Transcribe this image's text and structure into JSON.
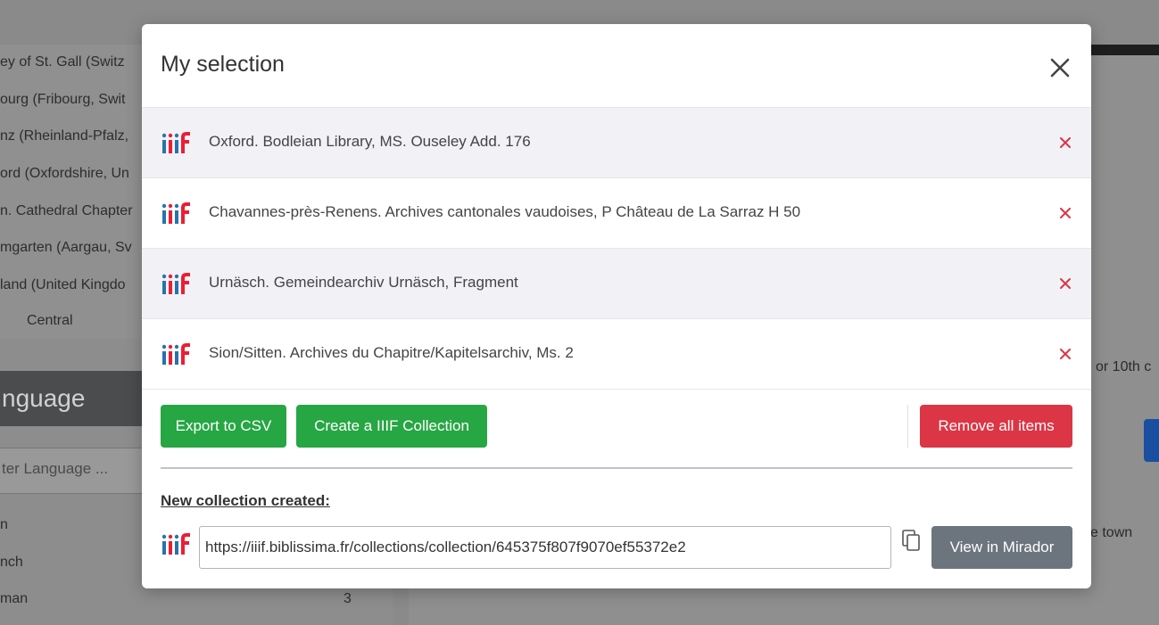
{
  "background": {
    "sidebar_items": [
      "ey of St. Gall (Switz",
      "ourg (Fribourg, Swit",
      "nz (Rheinland-Pfalz,",
      "ord (Oxfordshire, Un",
      "n. Cathedral Chapter",
      "mgarten (Aargau, Sv",
      "land (United Kingdo",
      "Central"
    ],
    "language_title": "nguage",
    "filter_placeholder": "ter Language ...",
    "language_rows": [
      "n",
      "nch",
      "man"
    ],
    "language_count": "3",
    "right_text_1": "or 10th c",
    "right_text_2": "e town"
  },
  "modal": {
    "title": "My selection",
    "items": [
      {
        "label": "Oxford. Bodleian Library, MS. Ouseley Add. 176"
      },
      {
        "label": "Chavannes-près-Renens. Archives cantonales vaudoises, P Château de La Sarraz H 50"
      },
      {
        "label": "Urnäsch. Gemeindearchiv Urnäsch, Fragment"
      },
      {
        "label": "Sion/Sitten. Archives du Chapitre/Kapitelsarchiv, Ms. 2"
      }
    ],
    "export_csv_label": "Export to CSV",
    "create_collection_label": "Create a IIIF Collection",
    "remove_all_label": "Remove all items",
    "collection_created_label": "New collection created:",
    "collection_url": "https://iiif.biblissima.fr/collections/collection/645375f807f9070ef55372e2",
    "view_mirador_label": "View in Mirador"
  },
  "colors": {
    "green": "#27a644",
    "red": "#dc3545",
    "gray": "#6c757d",
    "iiif_blue": "#2873ab",
    "iiif_red": "#ed1d33"
  },
  "icons": [
    "close-icon",
    "iiif-logo-icon",
    "remove-x-icon",
    "copy-icon"
  ]
}
